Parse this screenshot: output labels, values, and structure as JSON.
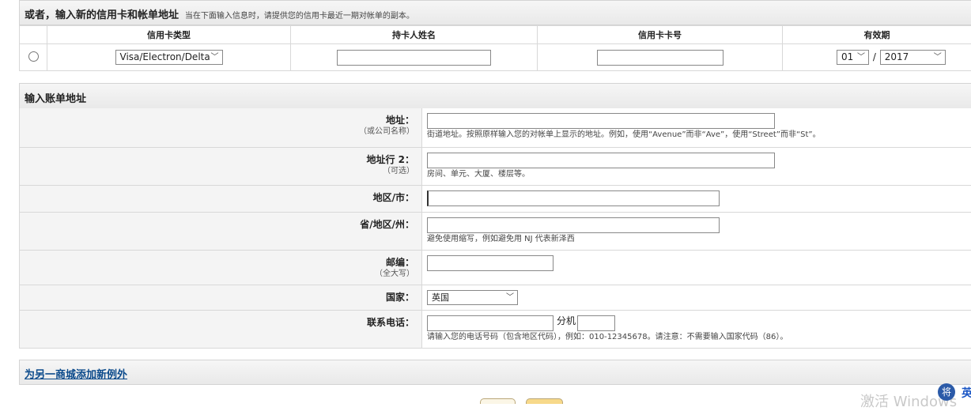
{
  "new_card": {
    "title": "或者，输入新的信用卡和帐单地址",
    "note": "当在下面输入信息时，请提供您的信用卡最近一期对帐单的副本。",
    "columns": [
      "信用卡类型",
      "持卡人姓名",
      "信用卡卡号",
      "有效期"
    ],
    "card_type": "Visa/Electron/Delta",
    "expiry_month": "01",
    "expiry_sep": "/",
    "expiry_year": "2017"
  },
  "billing": {
    "title": "输入账单地址",
    "address_label": "地址：",
    "address_sub": "（或公司名称）",
    "address_hint": "街道地址。按照原样输入您的对帐单上显示的地址。例如，使用“Avenue”而非“Ave”，使用“Street”而非“St”。",
    "address2_label": "地址行 2：",
    "address2_sub": "（可选）",
    "address2_hint": "房间、单元、大厦、楼层等。",
    "city_label": "地区/市：",
    "state_label": "省/地区/州：",
    "state_hint": "避免使用缩写，例如避免用 NJ 代表新泽西",
    "postcode_label": "邮编：",
    "postcode_sub": "（全大写）",
    "country_label": "国家：",
    "country_value": "英国",
    "phone_label": "联系电话：",
    "ext_label": "分机",
    "phone_hint": "请输入您的电话号码（包含地区代码），例如：010-12345678。请注意：不需要输入国家代码（86）。"
  },
  "exception": {
    "link": "为另一商城添加新例外"
  },
  "overlay": {
    "watermark": "激活 Windows",
    "tray_icon_char": "将",
    "tray_text": "英"
  }
}
